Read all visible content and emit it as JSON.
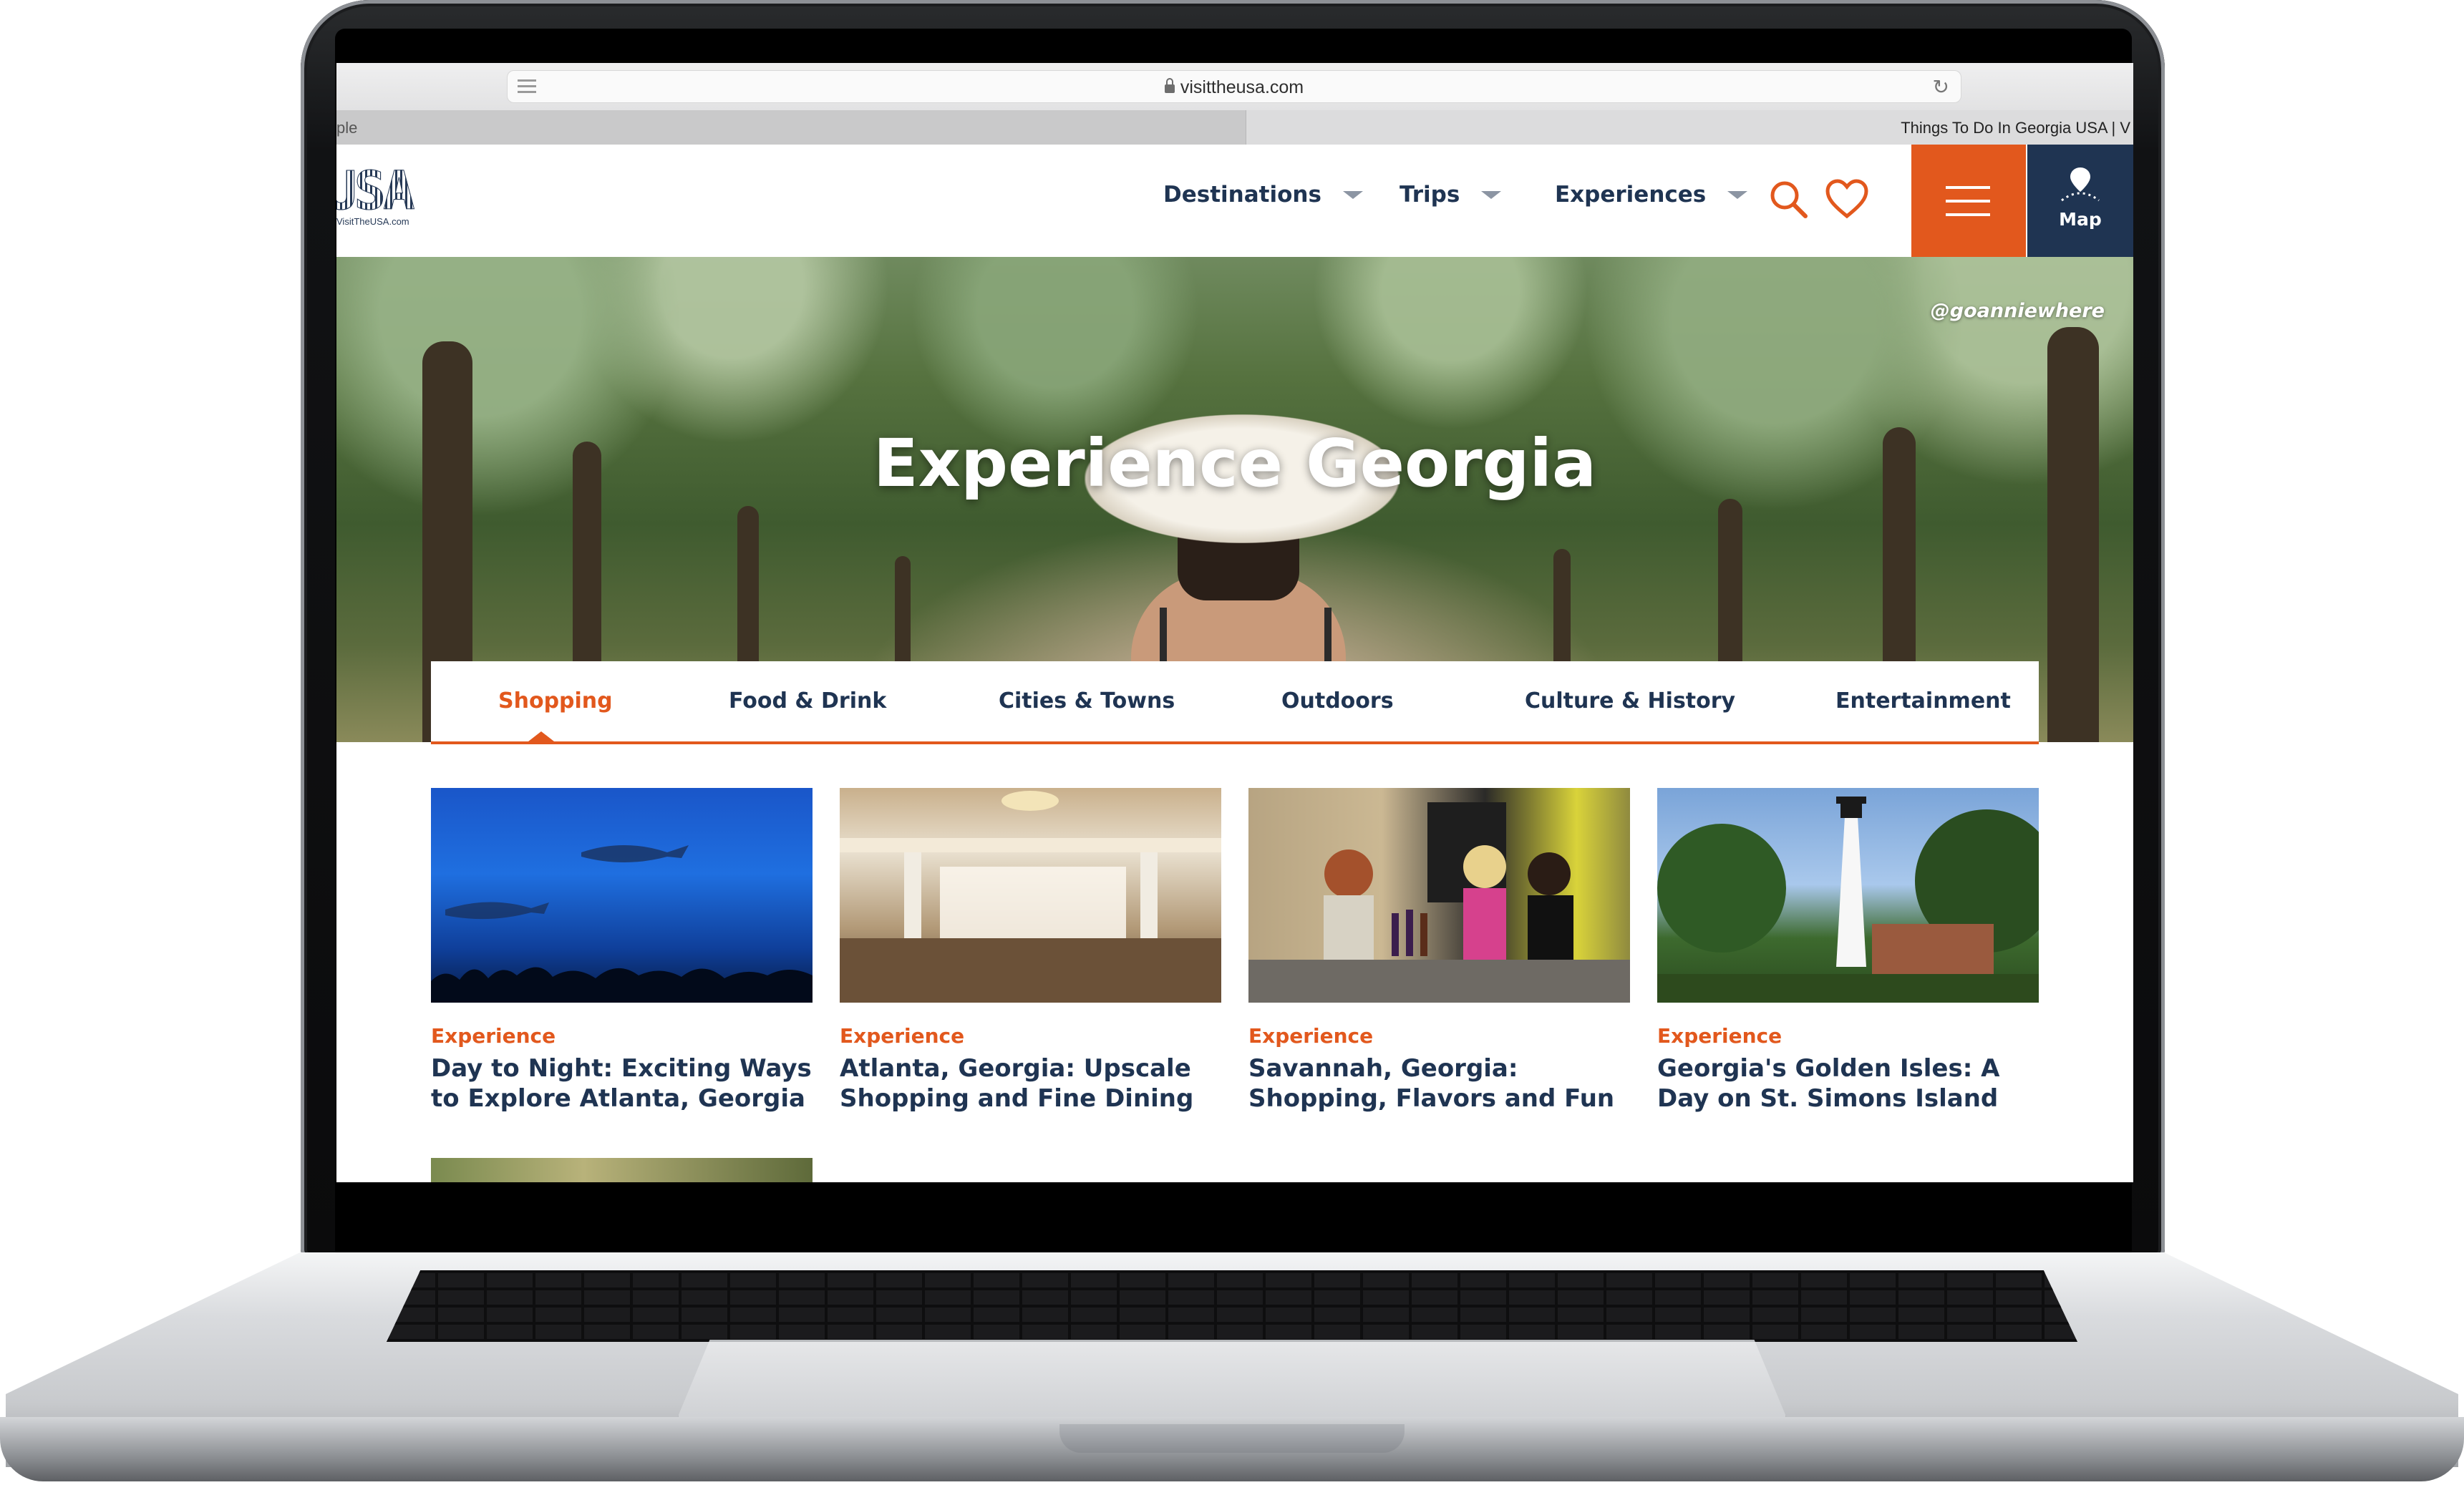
{
  "browser": {
    "url": "visittheusa.com",
    "tab_left_label": "ple",
    "tab_right_label": "Things To Do In Georgia USA | V"
  },
  "site": {
    "logo_text": "USA",
    "logo_sub": "VisitTheUSA.com",
    "nav": [
      {
        "label": "Destinations"
      },
      {
        "label": "Trips"
      },
      {
        "label": "Experiences"
      }
    ],
    "map_label": "Map",
    "accent_color": "#e2581d",
    "navy_color": "#1f3452"
  },
  "hero": {
    "title": "Experience Georgia",
    "credit": "@goanniewhere"
  },
  "categories": [
    {
      "label": "Shopping",
      "active": true
    },
    {
      "label": "Food & Drink",
      "active": false
    },
    {
      "label": "Cities & Towns",
      "active": false
    },
    {
      "label": "Outdoors",
      "active": false
    },
    {
      "label": "Culture & History",
      "active": false
    },
    {
      "label": "Entertainment",
      "active": false
    }
  ],
  "cards": [
    {
      "tag": "Experience",
      "title": "Day to Night: Exciting Ways to Explore Atlanta, Georgia"
    },
    {
      "tag": "Experience",
      "title": "Atlanta, Georgia: Upscale Shopping and Fine Dining"
    },
    {
      "tag": "Experience",
      "title": "Savannah, Georgia: Shopping, Flavors and Fun"
    },
    {
      "tag": "Experience",
      "title": "Georgia's Golden Isles: A Day on St. Simons Island"
    }
  ]
}
